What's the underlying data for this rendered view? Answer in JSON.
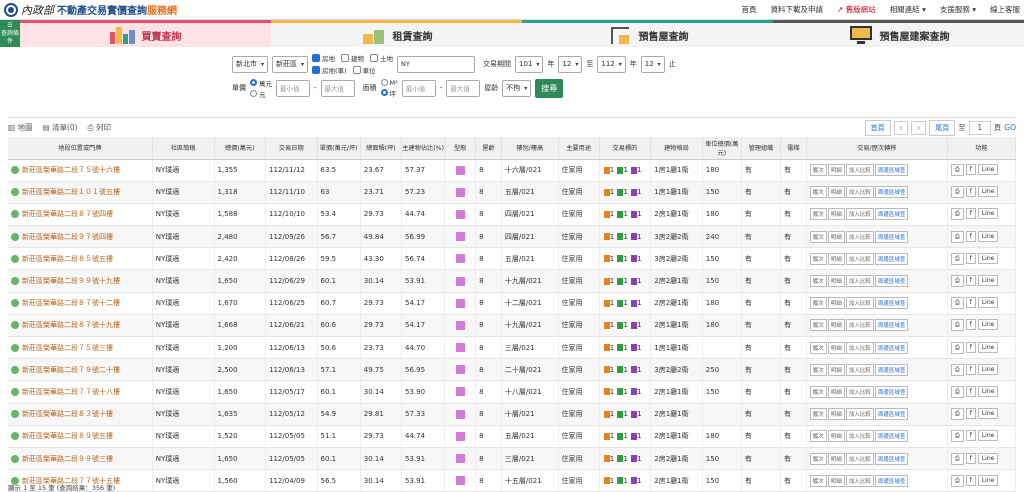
{
  "header": {
    "brand": "內政部",
    "title_main": "不動產交易實價查詢",
    "title_accent": "服務網",
    "links": [
      "首頁",
      "資料下載及申請",
      "舊版網站",
      "相關連結",
      "支援服務",
      "線上客服"
    ]
  },
  "tabs": {
    "side_label": "查詢條件",
    "items": [
      "買賣查詢",
      "租賃查詢",
      "預售屋查詢",
      "預售屋建案查詢"
    ]
  },
  "filters": {
    "city": "新北市",
    "district": "新莊區",
    "type_options": [
      "房地",
      "建物",
      "土地",
      "房地(車)",
      "車位"
    ],
    "type_checked": [
      true,
      false,
      false,
      true,
      false
    ],
    "keyword": "NY",
    "period_label": "交易期間",
    "from_year": "101",
    "from_month": "12",
    "to_label": "至",
    "to_year": "112",
    "to_month": "12",
    "year_unit": "年",
    "month_unit": "止",
    "price_label": "單價",
    "price_units": [
      "萬元",
      "元"
    ],
    "min_placeholder": "最小值",
    "max_placeholder": "最大值",
    "area_label": "面積",
    "area_units": [
      "M²",
      "坪"
    ],
    "age_label": "屋齡",
    "age_value": "不拘",
    "search": "搜尋"
  },
  "toolbar": {
    "map": "地圖",
    "list": "清單(0)",
    "print": "列印",
    "first": "首頁",
    "last": "尾頁",
    "to": "至",
    "page": "1",
    "pages": "頁",
    "go": "GO"
  },
  "columns": [
    "地段位置或門牌",
    "社區簡稱",
    "總價(萬元)",
    "交易日期",
    "單價(萬元/坪)",
    "總面積(坪)",
    "主建物佔比(%)",
    "型態",
    "屋齡",
    "樓別/樓高",
    "主要用途",
    "交易標的",
    "建物格局",
    "車位總價(萬元)",
    "管理組織",
    "電梯",
    "交易/歷次轉移",
    "功能"
  ],
  "actions": [
    "履次",
    "明細",
    "加入比較",
    "周邊區域查"
  ],
  "rows": [
    [
      "新莊區榮華路二段７５號十六樓",
      "NY璞適",
      "1,355",
      "112/11/12",
      "63.5",
      "23.67",
      "57.37",
      "8",
      "十六層/021",
      "住家用",
      "1房1廳1衛",
      "180",
      "有",
      "有"
    ],
    [
      "新莊區榮華路二段１０１號五樓",
      "NY璞適",
      "1,318",
      "112/11/10",
      "63",
      "23.71",
      "57.23",
      "8",
      "五層/021",
      "住家用",
      "1房1廳1衛",
      "150",
      "有",
      "有"
    ],
    [
      "新莊區榮華路二段８７號四樓",
      "NY璞適",
      "1,588",
      "112/10/10",
      "53.4",
      "29.73",
      "44.74",
      "8",
      "四層/021",
      "住家用",
      "2房1廳1衛",
      "180",
      "有",
      "有"
    ],
    [
      "新莊區榮華路二段９７號四樓",
      "NY璞適",
      "2,480",
      "112/09/26",
      "56.7",
      "49.84",
      "56.99",
      "8",
      "四層/021",
      "住家用",
      "3房2廳2衛",
      "240",
      "有",
      "有"
    ],
    [
      "新莊區榮華路二段８５號五樓",
      "NY璞適",
      "2,420",
      "112/08/26",
      "59.5",
      "43.30",
      "56.74",
      "8",
      "五層/021",
      "住家用",
      "3房2廳2衛",
      "150",
      "有",
      "有"
    ],
    [
      "新莊區榮華路二段９９號十九樓",
      "NY璞適",
      "1,650",
      "112/06/29",
      "60.1",
      "30.14",
      "53.91",
      "8",
      "十九層/021",
      "住家用",
      "2房2廳1衛",
      "150",
      "有",
      "有"
    ],
    [
      "新莊區榮華路二段８７號十二樓",
      "NY璞適",
      "1,670",
      "112/06/25",
      "60.7",
      "29.73",
      "54.17",
      "8",
      "十二層/021",
      "住家用",
      "2房2廳1衛",
      "180",
      "有",
      "有"
    ],
    [
      "新莊區榮華路二段８７號十九樓",
      "NY璞適",
      "1,668",
      "112/06/21",
      "60.6",
      "29.73",
      "54.17",
      "8",
      "十九層/021",
      "住家用",
      "2房1廳1衛",
      "180",
      "有",
      "有"
    ],
    [
      "新莊區榮華路二段７５號三樓",
      "NY璞適",
      "1,200",
      "112/06/13",
      "50.6",
      "23.73",
      "44.70",
      "8",
      "三層/021",
      "住家用",
      "1房1廳1衛",
      "",
      "有",
      "有"
    ],
    [
      "新莊區榮華路二段７９號二十樓",
      "NY璞適",
      "2,500",
      "112/06/13",
      "57.1",
      "49.75",
      "56.95",
      "8",
      "二十層/021",
      "住家用",
      "3房2廳2衛",
      "250",
      "有",
      "有"
    ],
    [
      "新莊區榮華路二段７７號十八樓",
      "NY璞適",
      "1,650",
      "112/05/17",
      "60.1",
      "30.14",
      "53.90",
      "8",
      "十八層/021",
      "住家用",
      "2房1廳1衛",
      "150",
      "有",
      "有"
    ],
    [
      "新莊區榮華路二段８３號十樓",
      "NY璞適",
      "1,635",
      "112/05/12",
      "54.9",
      "29.81",
      "57.33",
      "8",
      "十層/021",
      "住家用",
      "2房1廳1衛",
      "",
      "有",
      "有"
    ],
    [
      "新莊區榮華路二段８９號五樓",
      "NY璞適",
      "1,520",
      "112/05/05",
      "51.1",
      "29.73",
      "44.74",
      "8",
      "五層/021",
      "住家用",
      "2房1廳1衛",
      "180",
      "有",
      "有"
    ],
    [
      "新莊區榮華路二段９９號三樓",
      "NY璞適",
      "1,650",
      "112/05/05",
      "60.1",
      "30.14",
      "53.91",
      "8",
      "三層/021",
      "住家用",
      "2房2廳1衛",
      "150",
      "有",
      "有"
    ],
    [
      "新莊區榮華路二段７７號十五樓",
      "NY璞適",
      "1,560",
      "112/04/09",
      "56.5",
      "30.14",
      "53.91",
      "8",
      "十五層/021",
      "住家用",
      "2房1廳1衛",
      "150",
      "有",
      "有"
    ]
  ],
  "target_counts": [
    "1",
    "1",
    "1"
  ],
  "footer": "顯示 1 至 15 筆 (查詢結果：356 筆)"
}
